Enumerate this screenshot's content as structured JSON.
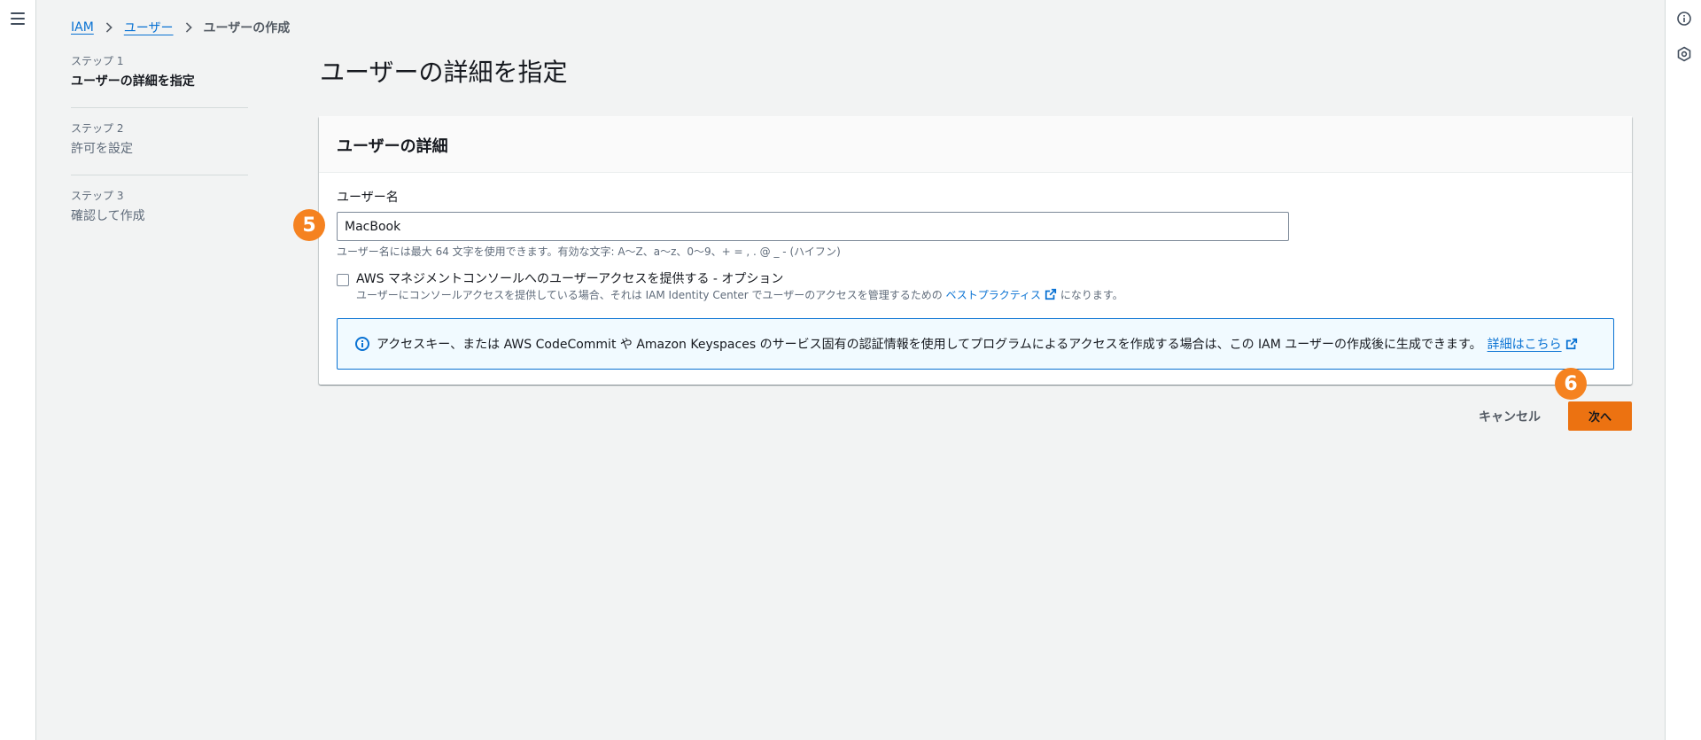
{
  "breadcrumb": {
    "items": [
      "IAM",
      "ユーザー"
    ],
    "current": "ユーザーの作成"
  },
  "steps": [
    {
      "num": "ステップ 1",
      "title": "ユーザーの詳細を指定",
      "active": true
    },
    {
      "num": "ステップ 2",
      "title": "許可を設定",
      "active": false
    },
    {
      "num": "ステップ 3",
      "title": "確認して作成",
      "active": false
    }
  ],
  "page_title": "ユーザーの詳細を指定",
  "card": {
    "header": "ユーザーの詳細",
    "username": {
      "label": "ユーザー名",
      "value": "MacBook",
      "constraint": "ユーザー名には最大 64 文字を使用できます。有効な文字: A〜Z、a〜z、0〜9、+ = , . @ _ - (ハイフン)"
    },
    "console_access": {
      "label": "AWS マネジメントコンソールへのユーザーアクセスを提供する - オプション",
      "desc_before": "ユーザーにコンソールアクセスを提供している場合、それは IAM Identity Center でユーザーのアクセスを管理するための",
      "desc_link": "ベストプラクティス",
      "desc_after": "になります。",
      "checked": false
    },
    "info": {
      "text": "アクセスキー、または AWS CodeCommit や Amazon Keyspaces のサービス固有の認証情報を使用してプログラムによるアクセスを作成する場合は、この IAM ユーザーの作成後に生成できます。",
      "link": "詳細はこちら"
    }
  },
  "buttons": {
    "cancel": "キャンセル",
    "next": "次へ"
  },
  "callouts": [
    "5",
    "6"
  ],
  "colors": {
    "accent": "#0972d3",
    "primary_button": "#ec7211",
    "callout": "#f58220",
    "background": "#f2f3f3"
  },
  "icons": [
    "menu-icon",
    "info-icon",
    "settings-icon",
    "external-link-icon"
  ]
}
